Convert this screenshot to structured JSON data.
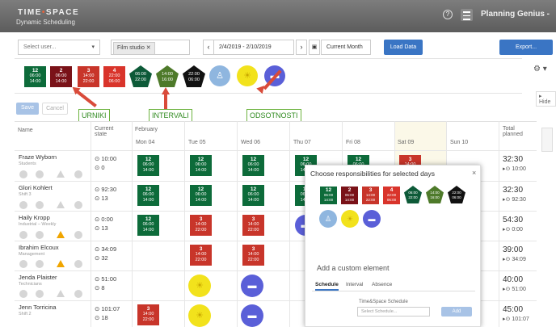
{
  "topbar": {
    "logo_time": "TIME",
    "logo_sep": "•",
    "logo_space": "SPACE",
    "logo_sub": "Dynamic Scheduling",
    "help": "?",
    "title": "Planning Genius -"
  },
  "filters": {
    "user_placeholder": "Select user...",
    "user_caret": "▾",
    "chip_label": "Film studio",
    "chip_close": "✕",
    "prev": "‹",
    "date_range": "2/4/2019 - 2/10/2019",
    "next": "›",
    "current_month": "Current Month",
    "load": "Load Data",
    "export": "Export..."
  },
  "palette": {
    "shifts": [
      {
        "top": "12",
        "a": "06:00",
        "b": "14:00",
        "color": "#0d6b3a"
      },
      {
        "top": "2",
        "a": "06:00",
        "b": "14:00",
        "color": "#7a1218"
      },
      {
        "top": "3",
        "a": "14:00",
        "b": "22:00",
        "color": "#c8352a"
      },
      {
        "top": "4",
        "a": "22:00",
        "b": "06:00",
        "color": "#d9342b"
      }
    ],
    "intervals": [
      {
        "a": "06:00",
        "b": "22:00",
        "color": "#0d5a38"
      },
      {
        "a": "14:00",
        "b": "16:00",
        "color": "#4e7a2a"
      },
      {
        "a": "22:00",
        "b": "06:00",
        "color": "#111111"
      }
    ],
    "absences": [
      {
        "icon": "♙",
        "color": "#8fb6df"
      },
      {
        "icon": "☀",
        "color": "#f2e21c"
      },
      {
        "icon": "▬",
        "color": "#5a5fd8"
      }
    ],
    "gear": "⚙ ▾",
    "hide": "▸ Hide"
  },
  "annotations": {
    "urniki": "URNIKI",
    "intervali": "INTERVALI",
    "odsotnosti": "ODSOTNOSTI"
  },
  "actions": {
    "save": "Save",
    "cancel": "Cancel"
  },
  "grid": {
    "name_header": "Name",
    "state_header": "Current state",
    "month": "February",
    "days": [
      "Mon 04",
      "Tue 05",
      "Wed 06",
      "Thu 07",
      "Fri 08",
      "Sat 09",
      "Sun 10"
    ],
    "total_header": "Total planned",
    "people": [
      {
        "name": "Fraze Wyborn",
        "role": "Students",
        "state1": "⊙ 10:00",
        "state2": "⊙ 0",
        "total": "32:30",
        "sub": "▸⊙ 10:00"
      },
      {
        "name": "Glori Kohlert",
        "role": "Shift 3",
        "state1": "⊙ 92:30",
        "state2": "⊙ 13",
        "total": "32:30",
        "sub": "▸⊙ 92:30"
      },
      {
        "name": "Haily Kropp",
        "role": "Industrial – Weekly",
        "state1": "⊙ 0:00",
        "state2": "⊙ 13",
        "total": "54:30",
        "sub": "▸⊙ 0:00"
      },
      {
        "name": "Ibrahim Elcoux",
        "role": "Management",
        "state1": "⊙ 34:09",
        "state2": "⊙ 32",
        "total": "39:00",
        "sub": "▸⊙ 34:09"
      },
      {
        "name": "Jenda Plaister",
        "role": "Technicians",
        "state1": "⊙ 51:00",
        "state2": "⊙ 8",
        "total": "40:00",
        "sub": "▸⊙ 51:00"
      },
      {
        "name": "Jenn Torricina",
        "role": "Shift 2",
        "state1": "⊙ 101:07",
        "state2": "⊙ 18",
        "total": "45:00",
        "sub": "▸⊙ 101:07"
      }
    ]
  },
  "popup": {
    "title": "Choose responsibilities for selected days",
    "close": "×",
    "custom": "Add a custom element",
    "tabs": [
      "Schedule",
      "Interval",
      "Absence"
    ],
    "schedule_label": "Time&Space Schedule",
    "schedule_placeholder": "Select Schedule...",
    "add": "Add"
  }
}
